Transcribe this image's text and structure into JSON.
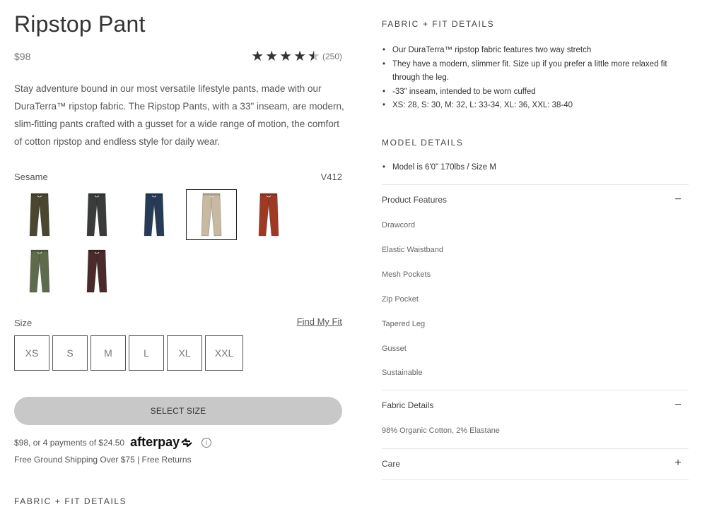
{
  "product": {
    "title": "Ripstop Pant",
    "price": "$98",
    "rating_count": "(250)",
    "rating_value": 4.5,
    "description": "Stay adventure bound in our most versatile lifestyle pants, made with our DuraTerra™ ripstop fabric. The Ripstop Pants, with a 33\" inseam, are modern, slim-fitting pants crafted with a gusset for a wide range of motion, the comfort of cotton ripstop and endless style for daily wear."
  },
  "color": {
    "selected_label": "Sesame",
    "sku": "V412",
    "swatches": [
      {
        "name": "olive",
        "color": "#4a4630"
      },
      {
        "name": "charcoal",
        "color": "#3a3b3b"
      },
      {
        "name": "navy",
        "color": "#273b56"
      },
      {
        "name": "sesame",
        "color": "#c8b9a0"
      },
      {
        "name": "rust",
        "color": "#9e3a23"
      },
      {
        "name": "camo",
        "color": "#5d6a4c"
      },
      {
        "name": "burgundy",
        "color": "#4b2a2c"
      }
    ]
  },
  "size": {
    "label": "Size",
    "find_fit": "Find My Fit",
    "options": [
      "XS",
      "S",
      "M",
      "L",
      "XL",
      "XXL"
    ]
  },
  "cta": {
    "select_size": "SELECT SIZE"
  },
  "afterpay": {
    "text": "$98, or 4 payments of $24.50",
    "logo": "afterpay",
    "info": "i"
  },
  "shipping": "Free Ground Shipping Over $75 | Free Returns",
  "left_fabric_heading": "FABRIC + FIT DETAILS",
  "fabric_fit": {
    "heading": "FABRIC + FIT DETAILS",
    "bullets": [
      "Our DuraTerra™ ripstop fabric features two way stretch",
      "They have a modern, slimmer fit. Size up if you prefer a little more relaxed fit through the leg.",
      "-33\" inseam, intended to be worn cuffed",
      "XS: 28, S: 30, M: 32, L: 33-34, XL: 36, XXL: 38-40"
    ]
  },
  "model": {
    "heading": "MODEL DETAILS",
    "bullets": [
      "Model is 6'0\" 170lbs / Size M"
    ]
  },
  "product_features": {
    "title": "Product Features",
    "toggle": "−",
    "items": [
      "Drawcord",
      "Elastic Waistband",
      "Mesh Pockets",
      "Zip Pocket",
      "Tapered Leg",
      "Gusset",
      "Sustainable"
    ]
  },
  "fabric_details": {
    "title": "Fabric Details",
    "toggle": "−",
    "content": "98% Organic Cotton, 2% Elastane"
  },
  "care": {
    "title": "Care",
    "toggle": "+"
  }
}
